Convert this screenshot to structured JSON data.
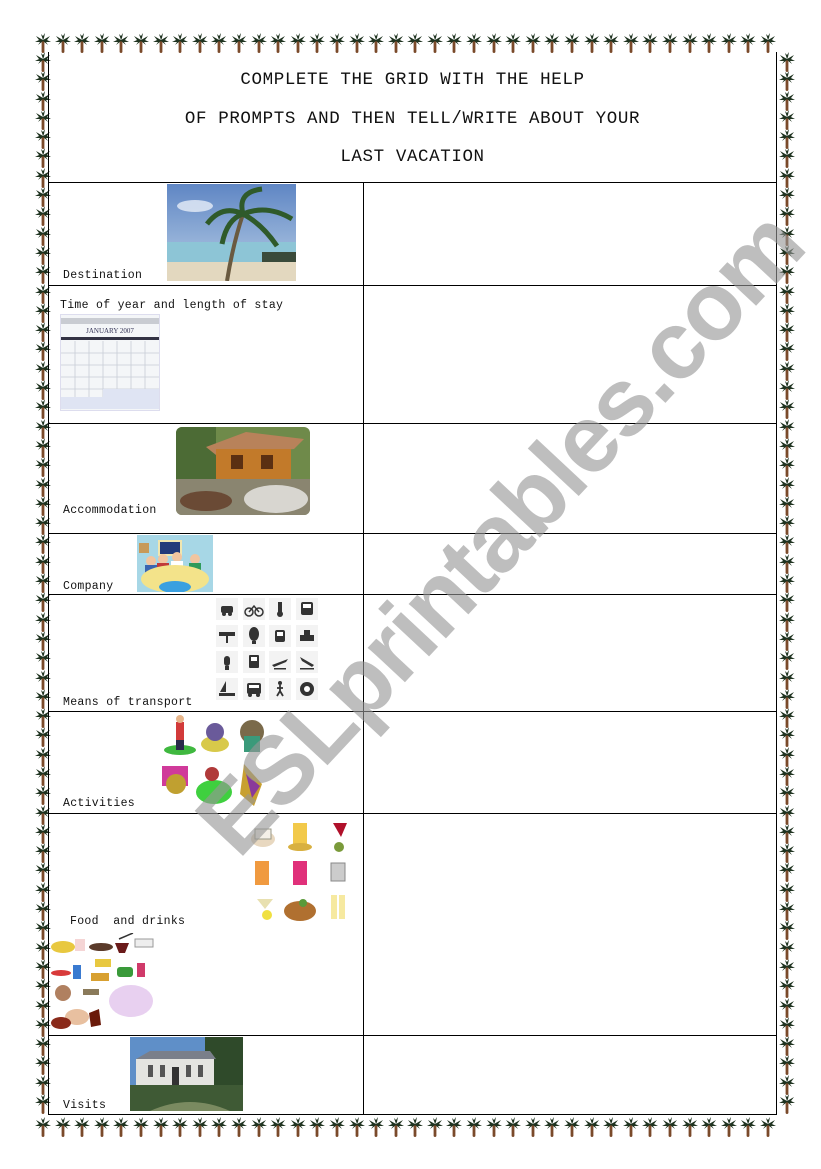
{
  "document": {
    "title_lines": [
      "COMPLETE THE GRID WITH THE HELP",
      "OF PROMPTS AND THEN TELL/WRITE ABOUT YOUR",
      "LAST VACATION"
    ],
    "watermark": "ESLprintables.com",
    "border_motif": "palm-tree-icon",
    "colors": {
      "palm_leaves": "#1f3320",
      "palm_trunk": "#7a4a2a",
      "rule_lines": "#000000",
      "watermark": "#9a9a9a"
    }
  },
  "grid": {
    "rows": [
      {
        "label": "Destination",
        "image": "tropical-beach-palm-photo",
        "answer": ""
      },
      {
        "label": "Time of year and length of stay",
        "image": "calendar-january-photo",
        "calendar_caption": "JANUARY 2007",
        "answer": ""
      },
      {
        "label": "Accommodation",
        "image": "wooden-cabin-photo",
        "answer": ""
      },
      {
        "label": "Company",
        "image": "family-at-table-cartoon",
        "answer": ""
      },
      {
        "label": "Means of transport",
        "image": "transport-icons-grid",
        "answer": ""
      },
      {
        "label": "Activities",
        "image": "sports-activities-clipart",
        "answer": ""
      },
      {
        "label": "Food  and drinks",
        "image": "drinks-and-food-clipart",
        "answer": ""
      },
      {
        "label": "Visits",
        "image": "historic-building-photo",
        "answer": ""
      }
    ]
  }
}
